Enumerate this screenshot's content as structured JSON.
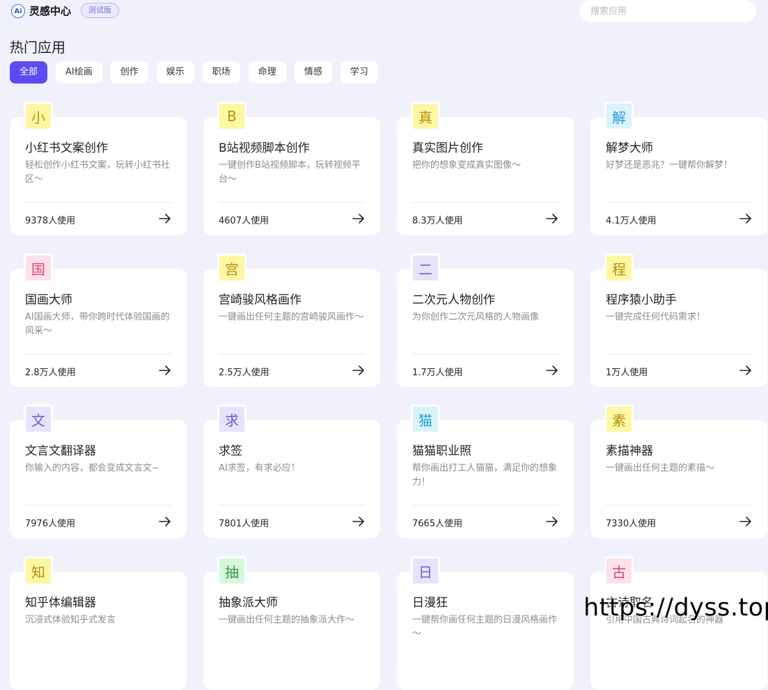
{
  "header": {
    "logo_text": "Ai",
    "brand": "灵感中心",
    "beta_label": "测试版",
    "search_placeholder": "搜索应用"
  },
  "section_title": "热门应用",
  "tabs": [
    {
      "label": "全部",
      "active": true
    },
    {
      "label": "AI绘画",
      "active": false
    },
    {
      "label": "创作",
      "active": false
    },
    {
      "label": "娱乐",
      "active": false
    },
    {
      "label": "职场",
      "active": false
    },
    {
      "label": "命理",
      "active": false
    },
    {
      "label": "情感",
      "active": false
    },
    {
      "label": "学习",
      "active": false
    }
  ],
  "apps": [
    {
      "badge": "小",
      "badge_bg": "#fdf7a3",
      "badge_color": "#b58f10",
      "title": "小红书文案创作",
      "desc": "轻松创作小红书文案，玩转小红书社区～",
      "usage": "9378人使用"
    },
    {
      "badge": "B",
      "badge_bg": "#fdf7a3",
      "badge_color": "#b58f10",
      "title": "B站视频脚本创作",
      "desc": "一键创作B站视频脚本，玩转视频平台～",
      "usage": "4607人使用"
    },
    {
      "badge": "真",
      "badge_bg": "#fdf7a3",
      "badge_color": "#b58f10",
      "title": "真实图片创作",
      "desc": "把你的想象变成真实图像～",
      "usage": "8.3万人使用"
    },
    {
      "badge": "解",
      "badge_bg": "#dbf2fb",
      "badge_color": "#2a9ecb",
      "title": "解梦大师",
      "desc": "好梦还是恶兆？一键帮你解梦！",
      "usage": "4.1万人使用"
    },
    {
      "badge": "国",
      "badge_bg": "#fde0ea",
      "badge_color": "#d9457a",
      "title": "国画大师",
      "desc": "AI国画大师，带你跨时代体验国画的风采～",
      "usage": "2.8万人使用"
    },
    {
      "badge": "宫",
      "badge_bg": "#fdf7a3",
      "badge_color": "#b58f10",
      "title": "宫崎骏风格画作",
      "desc": "一键画出任何主题的宫崎骏风画作～",
      "usage": "2.5万人使用"
    },
    {
      "badge": "二",
      "badge_bg": "#e6e3fb",
      "badge_color": "#6b5fd6",
      "title": "二次元人物创作",
      "desc": "为你创作二次元风格的人物画像",
      "usage": "1.7万人使用"
    },
    {
      "badge": "程",
      "badge_bg": "#fdf7a3",
      "badge_color": "#b58f10",
      "title": "程序猿小助手",
      "desc": "一键完成任何代码需求！",
      "usage": "1万人使用"
    },
    {
      "badge": "文",
      "badge_bg": "#e6e3fb",
      "badge_color": "#6b5fd6",
      "title": "文言文翻译器",
      "desc": "你输入的内容，都会变成文言文~",
      "usage": "7976人使用"
    },
    {
      "badge": "求",
      "badge_bg": "#e6e3fb",
      "badge_color": "#6b5fd6",
      "title": "求签",
      "desc": "AI求签，有求必应！",
      "usage": "7801人使用"
    },
    {
      "badge": "猫",
      "badge_bg": "#dbf2fb",
      "badge_color": "#2a9ecb",
      "title": "猫猫职业照",
      "desc": "帮你画出打工人猫猫，满足你的想象力！",
      "usage": "7665人使用"
    },
    {
      "badge": "素",
      "badge_bg": "#fdf7a3",
      "badge_color": "#b58f10",
      "title": "素描神器",
      "desc": "一键画出任何主题的素描～",
      "usage": "7330人使用"
    },
    {
      "badge": "知",
      "badge_bg": "#fdf7a3",
      "badge_color": "#b58f10",
      "title": "知乎体编辑器",
      "desc": "沉浸式体验知乎式发言",
      "usage": ""
    },
    {
      "badge": "抽",
      "badge_bg": "#d8f6dc",
      "badge_color": "#2e9e45",
      "title": "抽象派大师",
      "desc": "一键画出任何主题的抽象派大作～",
      "usage": ""
    },
    {
      "badge": "日",
      "badge_bg": "#e6e3fb",
      "badge_color": "#6b5fd6",
      "title": "日漫狂",
      "desc": "一键帮你画任何主题的日漫风格画作～",
      "usage": ""
    },
    {
      "badge": "古",
      "badge_bg": "#fde0ea",
      "badge_color": "#d9457a",
      "title": "古诗取名",
      "desc": "引用中国古典诗词起名的神器",
      "usage": ""
    }
  ],
  "watermark": "https://dyss.top"
}
